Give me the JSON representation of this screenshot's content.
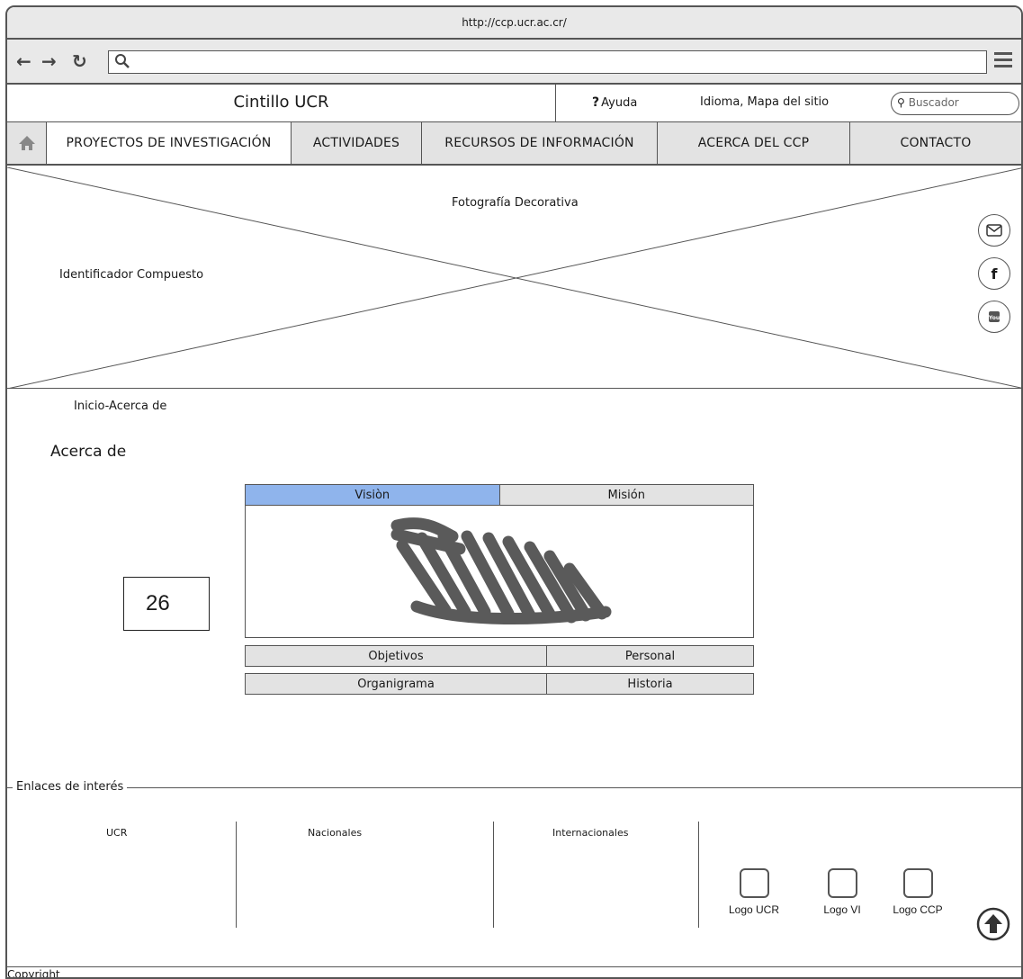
{
  "browser": {
    "url": "http://ccp.ucr.ac.cr/"
  },
  "cintillo": {
    "title": "Cintillo UCR",
    "help": "Ayuda",
    "help_mark": "?",
    "language_sitemap": "Idioma, Mapa del sitio",
    "search_placeholder": "Buscador"
  },
  "nav": {
    "items": [
      {
        "label": "PROYECTOS DE INVESTIGACIÓN"
      },
      {
        "label": "ACTIVIDADES"
      },
      {
        "label": "RECURSOS DE INFORMACIÓN"
      },
      {
        "label": "ACERCA DEL CCP"
      },
      {
        "label": "CONTACTO"
      }
    ]
  },
  "hero": {
    "caption": "Fotografía Decorativa",
    "identifier": "Identificador Compuesto",
    "social": [
      "email-icon",
      "facebook-icon",
      "youtube-icon"
    ]
  },
  "content": {
    "breadcrumb": "Inicio-Acerca de",
    "title": "Acerca de",
    "tabs": [
      {
        "label": "Visiòn",
        "selected": true
      },
      {
        "label": "Misión",
        "selected": false
      }
    ],
    "buttons_row1": [
      "Objetivos",
      "Personal"
    ],
    "buttons_row2": [
      "Organigrama",
      "Historia"
    ],
    "annotation_number": "26",
    "colors": {
      "selected_tab": "#8fb4ec",
      "button_bg": "#e3e3e3"
    }
  },
  "links": {
    "legend": "Enlaces de interés",
    "columns": [
      "UCR",
      "Nacionales",
      "Internacionales"
    ],
    "logos": [
      "Logo UCR",
      "Logo VI",
      "Logo CCP"
    ]
  },
  "footer": {
    "copyright": "Copyright"
  }
}
